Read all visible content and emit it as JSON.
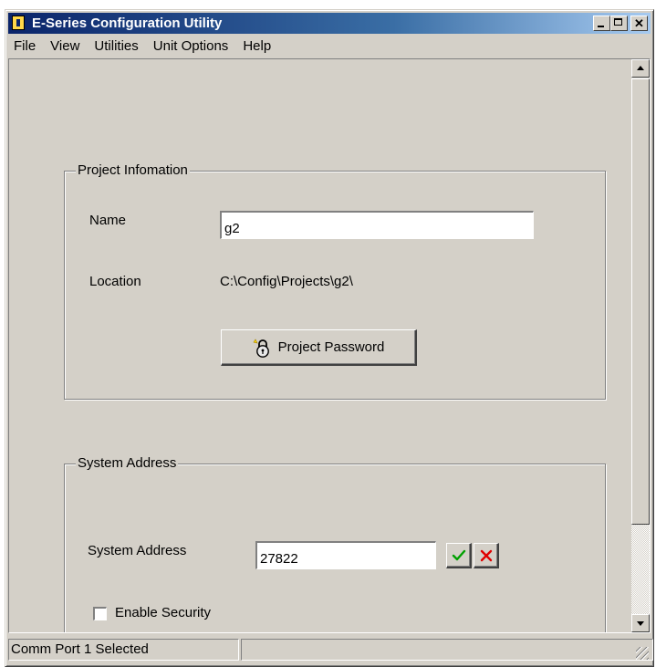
{
  "window": {
    "title": "E-Series Configuration Utility"
  },
  "menu": [
    {
      "label": "File"
    },
    {
      "label": "View"
    },
    {
      "label": "Utilities"
    },
    {
      "label": "Unit Options"
    },
    {
      "label": "Help"
    }
  ],
  "project_info": {
    "legend": "Project Infomation",
    "name_label": "Name",
    "name_value": "g2",
    "location_label": "Location",
    "location_value": "C:\\Config\\Projects\\g2\\",
    "password_button_label": "Project Password",
    "password_button_icon": "lock-icon"
  },
  "system_address": {
    "legend": "System Address",
    "field_label": "System Address",
    "field_value": "27822",
    "ok_icon": "checkmark-icon",
    "cancel_icon": "x-icon",
    "ok_color": "#00a000",
    "cancel_color": "#e00000",
    "enable_security_label": "Enable Security",
    "enable_security_checked": false
  },
  "status": {
    "panel1": "Comm Port 1 Selected",
    "panel2": ""
  },
  "colors": {
    "title_bar": "#0a246a",
    "face": "#d4d0c8"
  }
}
